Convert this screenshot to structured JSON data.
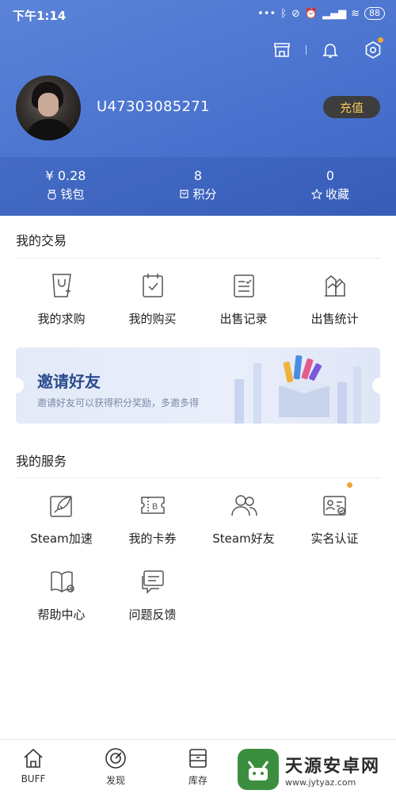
{
  "status": {
    "time": "下午1:14",
    "battery": "88"
  },
  "profile": {
    "username": "U47303085271",
    "recharge_label": "充值"
  },
  "stats": [
    {
      "value": "¥ 0.28",
      "label": "钱包",
      "icon": "wallet-icon"
    },
    {
      "value": "8",
      "label": "积分",
      "icon": "points-icon"
    },
    {
      "value": "0",
      "label": "收藏",
      "icon": "star-icon"
    }
  ],
  "trade": {
    "title": "我的交易",
    "items": [
      {
        "label": "我的求购",
        "icon": "request-icon"
      },
      {
        "label": "我的购买",
        "icon": "purchase-icon"
      },
      {
        "label": "出售记录",
        "icon": "sale-record-icon"
      },
      {
        "label": "出售统计",
        "icon": "sale-stats-icon"
      }
    ]
  },
  "banner": {
    "title": "邀请好友",
    "subtitle": "邀请好友可以获得积分奖励，多邀多得"
  },
  "services": {
    "title": "我的服务",
    "items": [
      {
        "label": "Steam加速",
        "icon": "rocket-icon"
      },
      {
        "label": "我的卡券",
        "icon": "coupon-icon"
      },
      {
        "label": "Steam好友",
        "icon": "friends-icon"
      },
      {
        "label": "实名认证",
        "icon": "id-verify-icon"
      },
      {
        "label": "帮助中心",
        "icon": "help-book-icon"
      },
      {
        "label": "问题反馈",
        "icon": "feedback-icon"
      }
    ]
  },
  "tabs": [
    {
      "label": "BUFF",
      "icon": "home-icon"
    },
    {
      "label": "发现",
      "icon": "discover-icon"
    },
    {
      "label": "库存",
      "icon": "inventory-icon"
    }
  ],
  "watermark": {
    "name": "天源安卓网",
    "url": "www.jytyaz.com"
  },
  "colors": {
    "header": "#4a73cf",
    "accent_dot": "#f3a531",
    "recharge_text": "#f1c35a"
  }
}
